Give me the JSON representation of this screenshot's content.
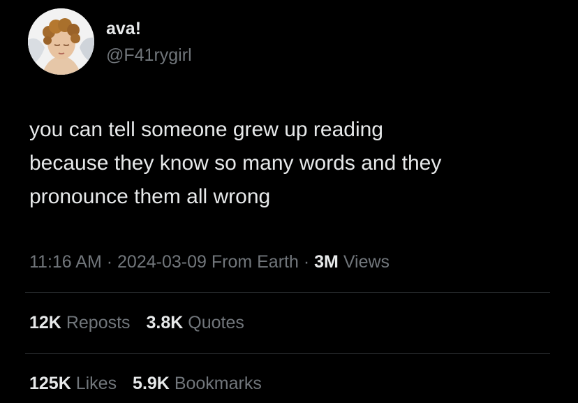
{
  "author": {
    "display_name": "ava!",
    "handle": "@F41rygirl",
    "avatar_icon": "cherub-portrait-avatar"
  },
  "tweet": {
    "text_lines": [
      "you can tell someone grew up reading",
      "because they know so many words and they",
      "pronounce them all wrong"
    ]
  },
  "meta": {
    "time": "11:16 AM",
    "separator": "·",
    "date": "2024-03-09",
    "source": "From Earth",
    "views_count": "3M",
    "views_label": "Views"
  },
  "stats": {
    "reposts_count": "12K",
    "reposts_label": "Reposts",
    "quotes_count": "3.8K",
    "quotes_label": "Quotes",
    "likes_count": "125K",
    "likes_label": "Likes",
    "bookmarks_count": "5.9K",
    "bookmarks_label": "Bookmarks"
  },
  "colors": {
    "background": "#000000",
    "primary_text": "#e7e9ea",
    "secondary_text": "#71767b",
    "divider": "#2f3336"
  }
}
